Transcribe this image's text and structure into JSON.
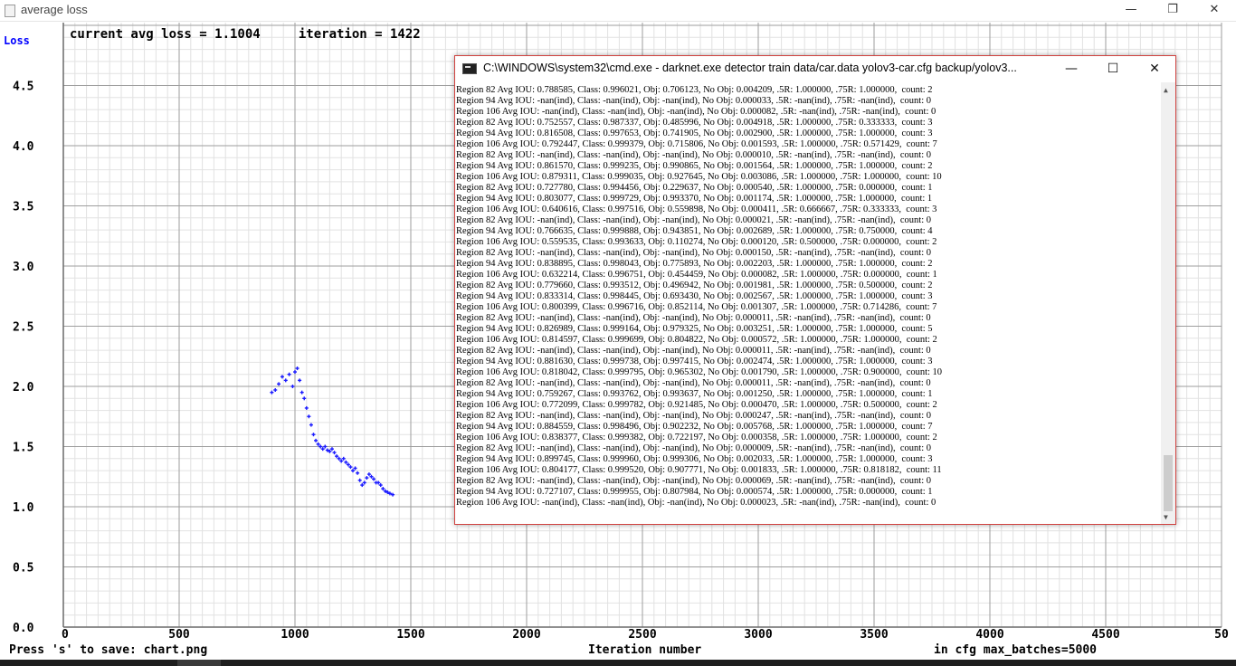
{
  "window": {
    "title": "average loss",
    "minimize_glyph": "—",
    "maximize_glyph": "❐",
    "close_glyph": "✕"
  },
  "chart_data": {
    "type": "scatter",
    "header_text": "current avg loss = 1.1004     iteration = 1422",
    "ylabel": "Loss",
    "xlabel": "Iteration number",
    "footer_left": "Press 's' to save: chart.png",
    "footer_right": "in cfg max_batches=5000",
    "xlim": [
      0,
      5000
    ],
    "ylim": [
      0.0,
      5.0
    ],
    "x_ticks": [
      "0",
      "500",
      "1000",
      "1500",
      "2000",
      "2500",
      "3000",
      "3500",
      "4000",
      "4500",
      "50"
    ],
    "y_ticks": [
      "0.0",
      "0.5",
      "1.0",
      "1.5",
      "2.0",
      "2.5",
      "3.0",
      "3.5",
      "4.0",
      "4.5"
    ],
    "point_color": "#1a1aff",
    "grid": true,
    "x": [
      900,
      915,
      930,
      945,
      960,
      975,
      990,
      1000,
      1010,
      1020,
      1030,
      1040,
      1050,
      1060,
      1070,
      1080,
      1090,
      1100,
      1110,
      1120,
      1130,
      1140,
      1150,
      1160,
      1170,
      1180,
      1190,
      1200,
      1210,
      1220,
      1230,
      1240,
      1250,
      1260,
      1270,
      1280,
      1290,
      1300,
      1310,
      1320,
      1330,
      1340,
      1350,
      1360,
      1370,
      1380,
      1390,
      1400,
      1410,
      1422
    ],
    "y": [
      1.95,
      1.97,
      2.02,
      2.08,
      2.05,
      2.1,
      2.0,
      2.12,
      2.15,
      2.05,
      1.95,
      1.9,
      1.82,
      1.75,
      1.68,
      1.6,
      1.55,
      1.52,
      1.5,
      1.48,
      1.5,
      1.47,
      1.46,
      1.48,
      1.45,
      1.42,
      1.4,
      1.38,
      1.4,
      1.37,
      1.35,
      1.33,
      1.3,
      1.32,
      1.28,
      1.22,
      1.18,
      1.2,
      1.24,
      1.27,
      1.25,
      1.23,
      1.2,
      1.2,
      1.18,
      1.15,
      1.13,
      1.12,
      1.11,
      1.1004
    ]
  },
  "cmd": {
    "title": "C:\\WINDOWS\\system32\\cmd.exe - darknet.exe  detector train data/car.data yolov3-car.cfg backup/yolov3...",
    "minimize_glyph": "—",
    "maximize_glyph": "☐",
    "close_glyph": "✕",
    "scroll_up_glyph": "▲",
    "scroll_down_glyph": "▼",
    "lines": [
      "Region 82 Avg IOU: 0.788585, Class: 0.996021, Obj: 0.706123, No Obj: 0.004209, .5R: 1.000000, .75R: 1.000000,  count: 2",
      "Region 94 Avg IOU: -nan(ind), Class: -nan(ind), Obj: -nan(ind), No Obj: 0.000033, .5R: -nan(ind), .75R: -nan(ind),  count: 0",
      "Region 106 Avg IOU: -nan(ind), Class: -nan(ind), Obj: -nan(ind), No Obj: 0.000082, .5R: -nan(ind), .75R: -nan(ind),  count: 0",
      "Region 82 Avg IOU: 0.752557, Class: 0.987337, Obj: 0.485996, No Obj: 0.004918, .5R: 1.000000, .75R: 0.333333,  count: 3",
      "Region 94 Avg IOU: 0.816508, Class: 0.997653, Obj: 0.741905, No Obj: 0.002900, .5R: 1.000000, .75R: 1.000000,  count: 3",
      "Region 106 Avg IOU: 0.792447, Class: 0.999379, Obj: 0.715806, No Obj: 0.001593, .5R: 1.000000, .75R: 0.571429,  count: 7",
      "Region 82 Avg IOU: -nan(ind), Class: -nan(ind), Obj: -nan(ind), No Obj: 0.000010, .5R: -nan(ind), .75R: -nan(ind),  count: 0",
      "Region 94 Avg IOU: 0.861570, Class: 0.999235, Obj: 0.990865, No Obj: 0.001564, .5R: 1.000000, .75R: 1.000000,  count: 2",
      "Region 106 Avg IOU: 0.879311, Class: 0.999035, Obj: 0.927645, No Obj: 0.003086, .5R: 1.000000, .75R: 1.000000,  count: 10",
      "Region 82 Avg IOU: 0.727780, Class: 0.994456, Obj: 0.229637, No Obj: 0.000540, .5R: 1.000000, .75R: 0.000000,  count: 1",
      "Region 94 Avg IOU: 0.803077, Class: 0.999729, Obj: 0.993370, No Obj: 0.001174, .5R: 1.000000, .75R: 1.000000,  count: 1",
      "Region 106 Avg IOU: 0.640616, Class: 0.997516, Obj: 0.559898, No Obj: 0.000411, .5R: 0.666667, .75R: 0.333333,  count: 3",
      "Region 82 Avg IOU: -nan(ind), Class: -nan(ind), Obj: -nan(ind), No Obj: 0.000021, .5R: -nan(ind), .75R: -nan(ind),  count: 0",
      "Region 94 Avg IOU: 0.766635, Class: 0.999888, Obj: 0.943851, No Obj: 0.002689, .5R: 1.000000, .75R: 0.750000,  count: 4",
      "Region 106 Avg IOU: 0.559535, Class: 0.993633, Obj: 0.110274, No Obj: 0.000120, .5R: 0.500000, .75R: 0.000000,  count: 2",
      "Region 82 Avg IOU: -nan(ind), Class: -nan(ind), Obj: -nan(ind), No Obj: 0.000150, .5R: -nan(ind), .75R: -nan(ind),  count: 0",
      "Region 94 Avg IOU: 0.838895, Class: 0.998043, Obj: 0.775893, No Obj: 0.002203, .5R: 1.000000, .75R: 1.000000,  count: 2",
      "Region 106 Avg IOU: 0.632214, Class: 0.996751, Obj: 0.454459, No Obj: 0.000082, .5R: 1.000000, .75R: 0.000000,  count: 1",
      "Region 82 Avg IOU: 0.779660, Class: 0.993512, Obj: 0.496942, No Obj: 0.001981, .5R: 1.000000, .75R: 0.500000,  count: 2",
      "Region 94 Avg IOU: 0.833314, Class: 0.998445, Obj: 0.693430, No Obj: 0.002567, .5R: 1.000000, .75R: 1.000000,  count: 3",
      "Region 106 Avg IOU: 0.800399, Class: 0.996716, Obj: 0.852114, No Obj: 0.001307, .5R: 1.000000, .75R: 0.714286,  count: 7",
      "Region 82 Avg IOU: -nan(ind), Class: -nan(ind), Obj: -nan(ind), No Obj: 0.000011, .5R: -nan(ind), .75R: -nan(ind),  count: 0",
      "Region 94 Avg IOU: 0.826989, Class: 0.999164, Obj: 0.979325, No Obj: 0.003251, .5R: 1.000000, .75R: 1.000000,  count: 5",
      "Region 106 Avg IOU: 0.814597, Class: 0.999699, Obj: 0.804822, No Obj: 0.000572, .5R: 1.000000, .75R: 1.000000,  count: 2",
      "Region 82 Avg IOU: -nan(ind), Class: -nan(ind), Obj: -nan(ind), No Obj: 0.000011, .5R: -nan(ind), .75R: -nan(ind),  count: 0",
      "Region 94 Avg IOU: 0.881630, Class: 0.999738, Obj: 0.997415, No Obj: 0.002474, .5R: 1.000000, .75R: 1.000000,  count: 3",
      "Region 106 Avg IOU: 0.818042, Class: 0.999795, Obj: 0.965302, No Obj: 0.001790, .5R: 1.000000, .75R: 0.900000,  count: 10",
      "Region 82 Avg IOU: -nan(ind), Class: -nan(ind), Obj: -nan(ind), No Obj: 0.000011, .5R: -nan(ind), .75R: -nan(ind),  count: 0",
      "Region 94 Avg IOU: 0.759267, Class: 0.993762, Obj: 0.993637, No Obj: 0.001250, .5R: 1.000000, .75R: 1.000000,  count: 1",
      "Region 106 Avg IOU: 0.772099, Class: 0.999782, Obj: 0.921485, No Obj: 0.000470, .5R: 1.000000, .75R: 0.500000,  count: 2",
      "Region 82 Avg IOU: -nan(ind), Class: -nan(ind), Obj: -nan(ind), No Obj: 0.000247, .5R: -nan(ind), .75R: -nan(ind),  count: 0",
      "Region 94 Avg IOU: 0.884559, Class: 0.998496, Obj: 0.902232, No Obj: 0.005768, .5R: 1.000000, .75R: 1.000000,  count: 7",
      "Region 106 Avg IOU: 0.838377, Class: 0.999382, Obj: 0.722197, No Obj: 0.000358, .5R: 1.000000, .75R: 1.000000,  count: 2",
      "Region 82 Avg IOU: -nan(ind), Class: -nan(ind), Obj: -nan(ind), No Obj: 0.000009, .5R: -nan(ind), .75R: -nan(ind),  count: 0",
      "Region 94 Avg IOU: 0.899745, Class: 0.999960, Obj: 0.999306, No Obj: 0.002033, .5R: 1.000000, .75R: 1.000000,  count: 3",
      "Region 106 Avg IOU: 0.804177, Class: 0.999520, Obj: 0.907771, No Obj: 0.001833, .5R: 1.000000, .75R: 0.818182,  count: 11",
      "Region 82 Avg IOU: -nan(ind), Class: -nan(ind), Obj: -nan(ind), No Obj: 0.000069, .5R: -nan(ind), .75R: -nan(ind),  count: 0",
      "Region 94 Avg IOU: 0.727107, Class: 0.999955, Obj: 0.807984, No Obj: 0.000574, .5R: 1.000000, .75R: 0.000000,  count: 1",
      "Region 106 Avg IOU: -nan(ind), Class: -nan(ind), Obj: -nan(ind), No Obj: 0.000023, .5R: -nan(ind), .75R: -nan(ind),  count: 0"
    ]
  }
}
